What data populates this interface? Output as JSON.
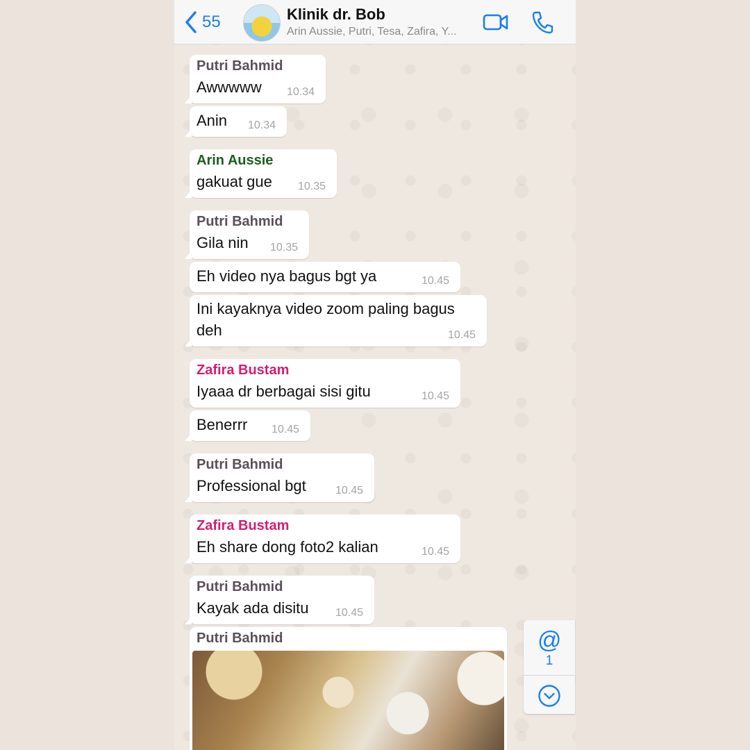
{
  "header": {
    "back_count": "55",
    "title": "Klinik dr. Bob",
    "subtitle": "Arin Aussie, Putri, Tesa, Zafira, Y..."
  },
  "colors": {
    "accent": "#1a7ff0",
    "putri": "#5b4f5a",
    "arin": "#1f5d1f",
    "zafira": "#d21e72"
  },
  "messages": [
    {
      "sender": "Putri Bahmid",
      "text": "Awwwww",
      "time": "10.34"
    },
    {
      "sender": "",
      "text": "Anin",
      "time": "10.34"
    },
    {
      "sender": "Arin Aussie",
      "text": "gakuat gue",
      "time": "10.35"
    },
    {
      "sender": "Putri Bahmid",
      "text": "Gila nin",
      "time": "10.35"
    },
    {
      "sender": "",
      "text": "Eh video nya bagus bgt ya",
      "time": "10.45"
    },
    {
      "sender": "",
      "text": "Ini kayaknya video zoom paling bagus",
      "text2": "deh",
      "time": "10.45"
    },
    {
      "sender": "Zafira Bustam",
      "text": "Iyaaa dr berbagai sisi gitu",
      "time": "10.45"
    },
    {
      "sender": "",
      "text": "Benerrr",
      "time": "10.45"
    },
    {
      "sender": "Putri Bahmid",
      "text": "Professional bgt",
      "time": "10.45"
    },
    {
      "sender": "Zafira Bustam",
      "text": "Eh share dong foto2 kalian",
      "time": "10.45"
    },
    {
      "sender": "Putri Bahmid",
      "text": "Kayak ada disitu",
      "time": "10.45"
    },
    {
      "sender": "Putri Bahmid"
    }
  ],
  "side_panel": {
    "mention_symbol": "@",
    "mention_count": "1"
  }
}
